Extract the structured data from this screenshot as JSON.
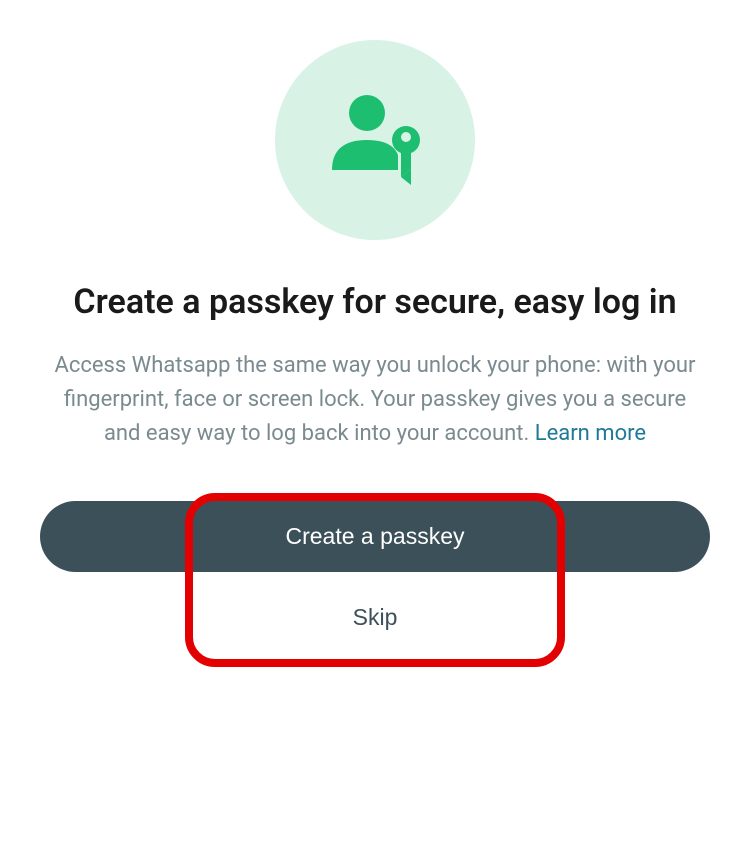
{
  "icon": {
    "name": "person-key-icon",
    "bg_color": "#d9f2e6",
    "fg_color": "#1ebe71"
  },
  "title": "Create a passkey for secure, easy log in",
  "description": "Access Whatsapp the same way you unlock your phone: with your fingerprint, face or screen lock. Your passkey gives you a secure and easy way to log back into your account.",
  "learn_more_label": "Learn more",
  "primary_button_label": "Create a passkey",
  "secondary_button_label": "Skip",
  "colors": {
    "accent": "#1ebe71",
    "button_bg": "#3c5059",
    "link": "#1f7a99",
    "highlight": "#e30000"
  }
}
